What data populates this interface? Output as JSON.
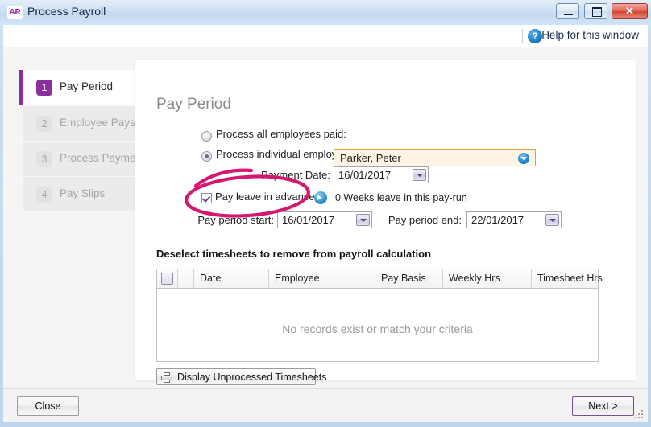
{
  "window": {
    "logo_text": "AR",
    "title": "Process Payroll",
    "minimize_label": "Minimize",
    "maximize_label": "Maximize",
    "close_label": "Close"
  },
  "helpbar": {
    "icon": "question-mark-icon",
    "link_label": "Help for this window",
    "icon_glyph": "?"
  },
  "sidebar": {
    "steps": [
      {
        "num": "1",
        "label": "Pay Period",
        "state": "active"
      },
      {
        "num": "2",
        "label": "Employee Pays",
        "state": "disabled"
      },
      {
        "num": "3",
        "label": "Process Payments",
        "state": "disabled"
      },
      {
        "num": "4",
        "label": "Pay Slips",
        "state": "disabled"
      }
    ]
  },
  "panel": {
    "title": "Pay Period",
    "radio_all_label": "Process all employees paid:",
    "radio_all_selected": false,
    "radio_individual_label": "Process individual employee:",
    "radio_individual_selected": true,
    "employee_value": "Parker, Peter",
    "employee_dropdown_icon": "chevron-down-circle-icon",
    "payment_date_label": "Payment Date:",
    "payment_date_value": "16/01/2017",
    "pay_leave_label": "Pay leave in advance:",
    "pay_leave_checked": true,
    "leave_arrow_icon": "arrow-right-circle-icon",
    "leave_note": "0 Weeks leave in this pay-run",
    "period_start_label": "Pay period start:",
    "period_start_value": "16/01/2017",
    "period_end_label": "Pay period end:",
    "period_end_value": "22/01/2017",
    "grid_caption": "Deselect timesheets to remove from payroll calculation",
    "grid_headers": [
      "",
      "",
      "Date",
      "Employee",
      "Pay Basis",
      "Weekly Hrs",
      "Timesheet Hrs"
    ],
    "grid_rows": [],
    "grid_empty_message": "No records exist or match your criteria",
    "display_timesheets_label": "Display Unprocessed Timesheets",
    "printer_icon": "printer-icon"
  },
  "footer": {
    "close_label": "Close",
    "next_label": "Next >",
    "resize_grip": "resize-grip-icon"
  },
  "annotation": {
    "type": "ellipse-highlight",
    "color": "#d6176f",
    "target": "pay-leave-in-advance-checkbox"
  },
  "colors": {
    "accent_purple": "#8b2fa0",
    "annotation_pink": "#d6176f",
    "field_border_orange": "#d9a441",
    "field_bg_cream": "#fdf4e3"
  }
}
